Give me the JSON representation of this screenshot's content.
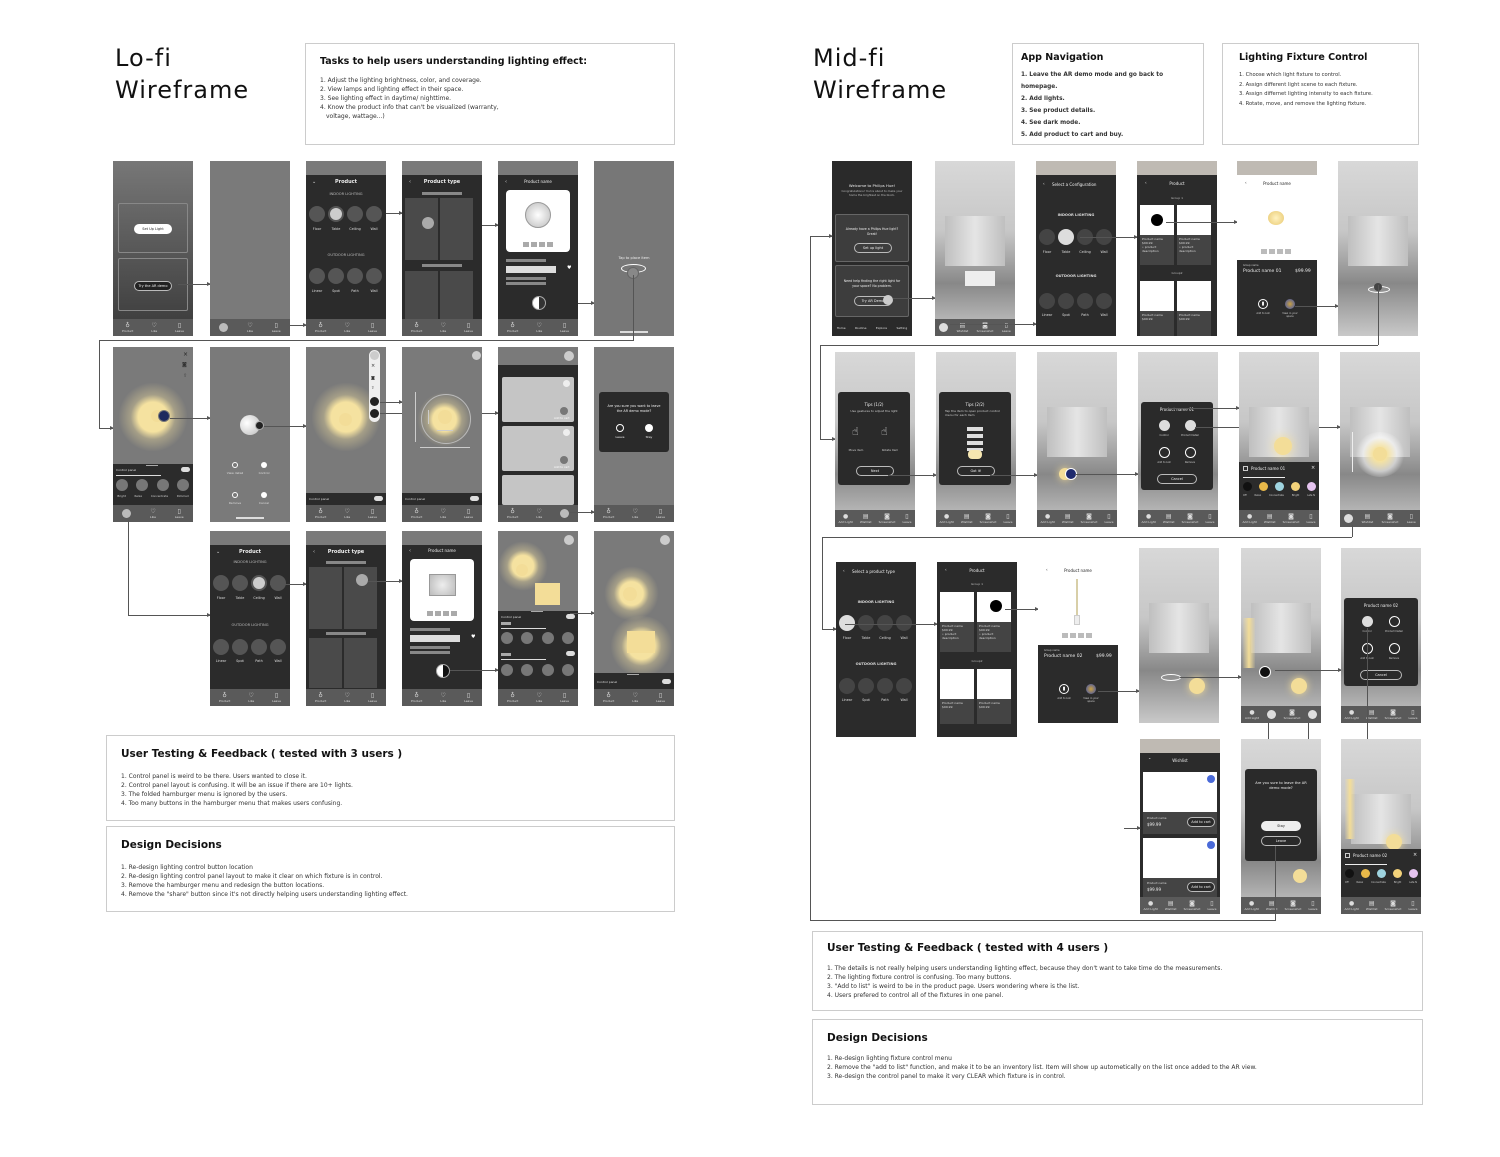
{
  "lofi": {
    "title_line1": "Lo-fi",
    "title_line2": "Wireframe",
    "tasks": {
      "heading": "Tasks to help users understanding lighting effect:",
      "items": [
        "1. Adjust the lighting brightness, color, and coverage.",
        "2. View lamps and lighting effect in their space.",
        "3. See lighting effect in daytime/ nighttime.",
        "4. Know the product info that can't be visualized (warranty,",
        "   voltage, wattage...)"
      ]
    },
    "screens": {
      "home": {
        "setup_button": "Set Up Light",
        "demo_button": "Try the AR demo"
      },
      "product": {
        "title": "Product",
        "indoor_label": "INDOOR LIGHTING",
        "outdoor_label": "OUTDOOR LIGHTING",
        "indoor": [
          "Floor",
          "Table",
          "Ceiling",
          "Wall"
        ],
        "outdoor": [
          "Linear",
          "Spot",
          "Path",
          "Wall"
        ]
      },
      "product_type": {
        "title": "Product type"
      },
      "product_name": {
        "title": "Product name"
      },
      "place": {
        "hint": "Tap to place item"
      },
      "control_panel_label": "Control panel",
      "scenes": [
        "Bright",
        "Relax",
        "Concentrate",
        "Dimmed"
      ],
      "item_menu": {
        "view_detail": "View detail",
        "control": "Control",
        "remove": "Remove",
        "cancel": "Cancel"
      },
      "wishlist_add": "Add to cart",
      "leave_dialog": {
        "text": "Are you sure you want to leave the AR demo mode?",
        "leave": "Leave",
        "stay": "Stay"
      },
      "tabbar": [
        "Product",
        "Like",
        "Leave"
      ]
    },
    "feedback": {
      "heading": "User Testing & Feedback ( tested with 3 users )",
      "items": [
        "1. Control panel is weird to be there. Users wanted to close it.",
        "2. Control panel layout is confusing. It will be an issue if there are 10+ lights.",
        "3. The folded hamburger menu is ignored by the users.",
        "4. Too many buttons in the hamburger menu that makes users confusing."
      ]
    },
    "decisions": {
      "heading": "Design Decisions",
      "items": [
        "1. Re-design lighting control button location",
        "2. Re-design lighting control panel layout to make it clear on which fixture is in control.",
        "3. Remove the hamburger menu and redesign the button locations.",
        "4. Remove the \"share\" button since it's not directly helping users understanding lighting effect."
      ]
    }
  },
  "midfi": {
    "title_line1": "Mid-fi",
    "title_line2": "Wireframe",
    "nav_box": {
      "heading": "App Navigation",
      "items": [
        "1. Leave the AR demo mode and go back to homepage.",
        "2. Add lights.",
        "3. See product details.",
        "4. See dark mode.",
        "5. Add product to cart and buy."
      ]
    },
    "control_box": {
      "heading": "Lighting Fixture Control",
      "items": [
        "1. Choose which light fixture to control.",
        "2. Assign different light scene to each fixture.",
        "3. Assign differnet lighting intensity to each fixture.",
        "4. Rotate, move, and remove the lighting fixture."
      ]
    },
    "screens": {
      "welcome": {
        "title": "Welcome to Philips Hue!",
        "subtitle": "Congratulations! You're about to make your home the brightest on the block.",
        "card1_text": "Already have a Philips Hue light? Great!",
        "card1_button": "Set up light",
        "card2_text": "Need help finding the right light for your space? No problem.",
        "card2_button": "Try AR Demo",
        "tabbar": [
          "Home",
          "Routine",
          "Explore",
          "Setting"
        ]
      },
      "select_config": {
        "title": "Select a Configuration"
      },
      "select_type": {
        "title": "Select a product type"
      },
      "indoor_label": "INDOOR LIGHTING",
      "outdoor_label": "OUTDOOR LIGHTING",
      "indoor": [
        "Floor",
        "Table",
        "Ceiling",
        "Wall"
      ],
      "outdoor": [
        "Linear",
        "Spot",
        "Path",
        "Wall"
      ],
      "product_list": {
        "title": "Product",
        "group1": "Group 1",
        "group2": "Group2",
        "card_name": "Product name",
        "card_price": "$99.99",
        "card_desc": "• product description"
      },
      "product_detail_1": {
        "title": "Product name",
        "group": "Group name",
        "name": "Product name 01",
        "price": "$99.99",
        "add_to_list": "Add to List",
        "view_in_space": "View in your space"
      },
      "product_detail_2": {
        "title": "Product name",
        "group": "Group name",
        "name": "Product name 02",
        "price": "$99.99",
        "add_to_list": "Add to List",
        "view_in_space": "View in your space"
      },
      "tips1": {
        "title": "Tips (1/2)",
        "text": "Use gestures to adjust the light",
        "move": "Move item",
        "rotate": "Rotate item",
        "button": "Next"
      },
      "tips2": {
        "title": "Tips (2/2)",
        "text": "Tap the item to open product control menu for each item",
        "button": "Got it!"
      },
      "fixture_menu_1": {
        "title": "Product name 01",
        "control": "Control",
        "detail": "Product Detail",
        "add": "Add to List",
        "remove": "Remove",
        "cancel": "Cancel"
      },
      "fixture_menu_2": {
        "title": "Product name 02",
        "control": "Control",
        "detail": "Product Detail",
        "add": "Add to List",
        "remove": "Remove",
        "cancel": "Cancel"
      },
      "panel_1": {
        "title": "Product name 01"
      },
      "panel_2": {
        "title": "Product name 02"
      },
      "scenes": [
        "Off",
        "Relax",
        "Concentrate",
        "Bright",
        "Late N"
      ],
      "scene_colors": [
        "#111111",
        "#e9b949",
        "#9fd4e0",
        "#f3d27a",
        "#e5c3ef"
      ],
      "wishlist": {
        "title": "Wishlist",
        "name": "Product name",
        "price": "$99.99",
        "button": "Add to cart"
      },
      "leave_dialog": {
        "text": "Are you sure to leave the AR demo mode?",
        "stay": "Stay",
        "leave": "Leave"
      },
      "tabbar": [
        "Add Light",
        "Wishlist",
        "Screenshot",
        "Leave"
      ]
    },
    "feedback": {
      "heading": "User Testing & Feedback  ( tested with 4 users )",
      "items": [
        "1. The details is not really helping users understanding lighting effect, because they don't want to take time do the measurements.",
        "2. The lighting fixture control is confusing. Too many buttons.",
        "3. \"Add to list\" is weird to be in the product page. Users wondering where is the list.",
        "4. Users prefered to control all of the fixtures in one panel."
      ]
    },
    "decisions": {
      "heading": "Design Decisions",
      "items": [
        "1. Re-design lighting fixture control menu",
        "2. Remove the \"add to list\" function, and make it to be an inventory list. Item will show up autometically on the list once added to the AR view.",
        "3. Re-design the control panel to make it very CLEAR which fixture is in control."
      ]
    }
  }
}
